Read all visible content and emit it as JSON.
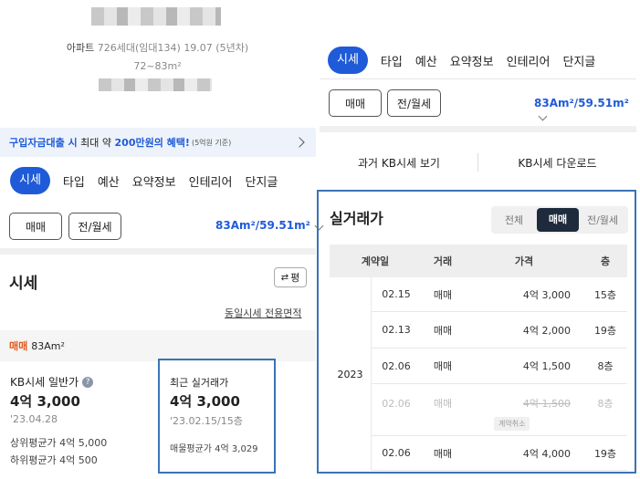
{
  "left": {
    "summary": {
      "type_label": "아파트",
      "households": "726세대(임대134)",
      "built": "19.07 (5년차)",
      "area_range": "72~83m²"
    },
    "banner": {
      "highlight1": "구입자금대출 시",
      "mid": " 최대 약 ",
      "highlight2": "200만원의 혜택!",
      "note": "(5억원 기준)"
    },
    "tabs": [
      "시세",
      "타입",
      "예산",
      "요약정보",
      "인테리어",
      "단지글"
    ],
    "trade_buttons": [
      "매매",
      "전/월세"
    ],
    "area_select": "83Am²/59.51m²",
    "price": {
      "title": "시세",
      "sort_label": "평",
      "same_area_link": "동일시세 전용면적",
      "deal_type": "매매",
      "area": "83Am²",
      "kb_label": "KB시세 일반가",
      "kb_price": "4억 3,000",
      "kb_date": "'23.04.28",
      "upper_avg": "상위평균가 4억 5,000",
      "lower_avg": "하위평균가 4억 500",
      "recent_label": "최근 실거래가",
      "recent_price": "4억 3,000",
      "recent_info": "'23.02.15/15층",
      "listing_avg": "매물평균가 4억 3,029"
    }
  },
  "right": {
    "tabs": [
      "시세",
      "타입",
      "예산",
      "요약정보",
      "인테리어",
      "단지글"
    ],
    "trade_buttons": [
      "매매",
      "전/월세"
    ],
    "area_select": "83Am²/59.51m²",
    "links": [
      "과거 KB시세 보기",
      "KB시세 다운로드"
    ],
    "transactions": {
      "title": "실거래가",
      "filters": [
        "전체",
        "매매",
        "전/월세"
      ],
      "columns": [
        "계약일",
        "거래",
        "가격",
        "층"
      ],
      "year": "2023",
      "rows": [
        {
          "date": "02.15",
          "type": "매매",
          "price": "4억 3,000",
          "floor": "15층",
          "canceled": false,
          "badge": ""
        },
        {
          "date": "02.13",
          "type": "매매",
          "price": "4억 2,000",
          "floor": "19층",
          "canceled": false,
          "badge": ""
        },
        {
          "date": "02.06",
          "type": "매매",
          "price": "4억 1,500",
          "floor": "8층",
          "canceled": false,
          "badge": ""
        },
        {
          "date": "02.06",
          "type": "매매",
          "price": "4억 1,500",
          "floor": "8층",
          "canceled": true,
          "badge": "계약취소"
        },
        {
          "date": "02.06",
          "type": "매매",
          "price": "4억 4,000",
          "floor": "19층",
          "canceled": false,
          "badge": ""
        }
      ]
    }
  },
  "colors": {
    "accent": "#1f5bd8",
    "dark_chip": "#1e2b3c",
    "highlight_border": "#3b73b6",
    "banner_bg": "#eef3fb"
  }
}
